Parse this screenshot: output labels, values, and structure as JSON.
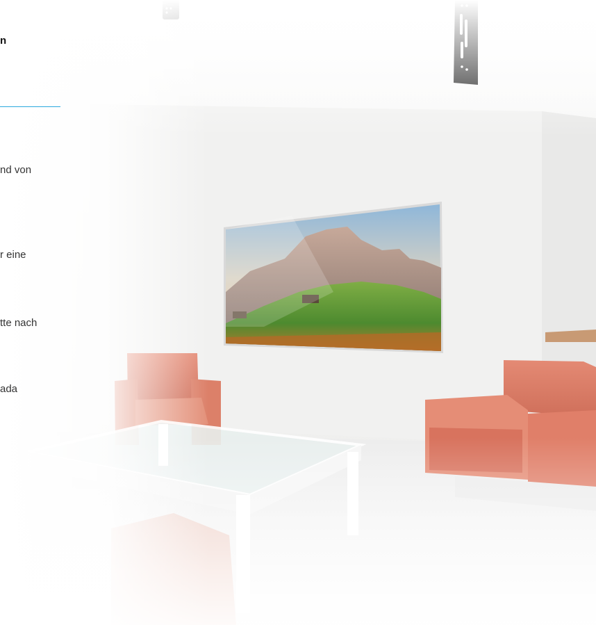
{
  "left_panel": {
    "title_fragment": "n",
    "text_lines": [
      "nd von",
      "r eine",
      "tte nach",
      "ada"
    ]
  },
  "scene": {
    "description_items": [
      "wall-bracket-left",
      "wall-bracket-right",
      "wall-mounted-tv",
      "armchair-left",
      "armchair-right",
      "glass-coffee-table"
    ],
    "accent_color": "#2aa8de",
    "armchair_color": "#e98b74"
  }
}
